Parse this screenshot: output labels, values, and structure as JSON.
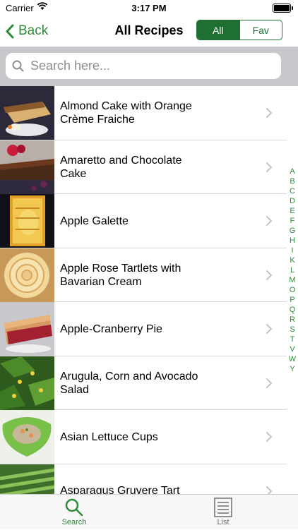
{
  "status_bar": {
    "carrier": "Carrier",
    "time": "3:17 PM"
  },
  "nav": {
    "back_label": "Back",
    "title": "All Recipes",
    "segments": [
      "All",
      "Fav"
    ],
    "selected_segment": "All"
  },
  "search": {
    "placeholder": "Search here...",
    "value": ""
  },
  "recipes": [
    {
      "name": "Almond Cake with Orange Crème Fraiche"
    },
    {
      "name": "Amaretto and Chocolate Cake"
    },
    {
      "name": "Apple Galette"
    },
    {
      "name": "Apple Rose Tartlets with Bavarian Cream"
    },
    {
      "name": "Apple-Cranberry Pie"
    },
    {
      "name": "Arugula, Corn and Avocado Salad"
    },
    {
      "name": "Asian Lettuce Cups"
    },
    {
      "name": "Asparagus Gruyere Tart"
    }
  ],
  "index_letters": [
    "A",
    "B",
    "C",
    "D",
    "E",
    "F",
    "G",
    "H",
    "I",
    "K",
    "L",
    "M",
    "O",
    "P",
    "Q",
    "R",
    "S",
    "T",
    "V",
    "W",
    "Y"
  ],
  "tabs": [
    {
      "label": "Search",
      "icon": "search-icon",
      "active": true
    },
    {
      "label": "List",
      "icon": "list-icon",
      "active": false
    }
  ],
  "colors": {
    "accent": "#2e8b3a",
    "segment_dark": "#1f6e32",
    "search_bar_bg": "#c8c8cc"
  }
}
